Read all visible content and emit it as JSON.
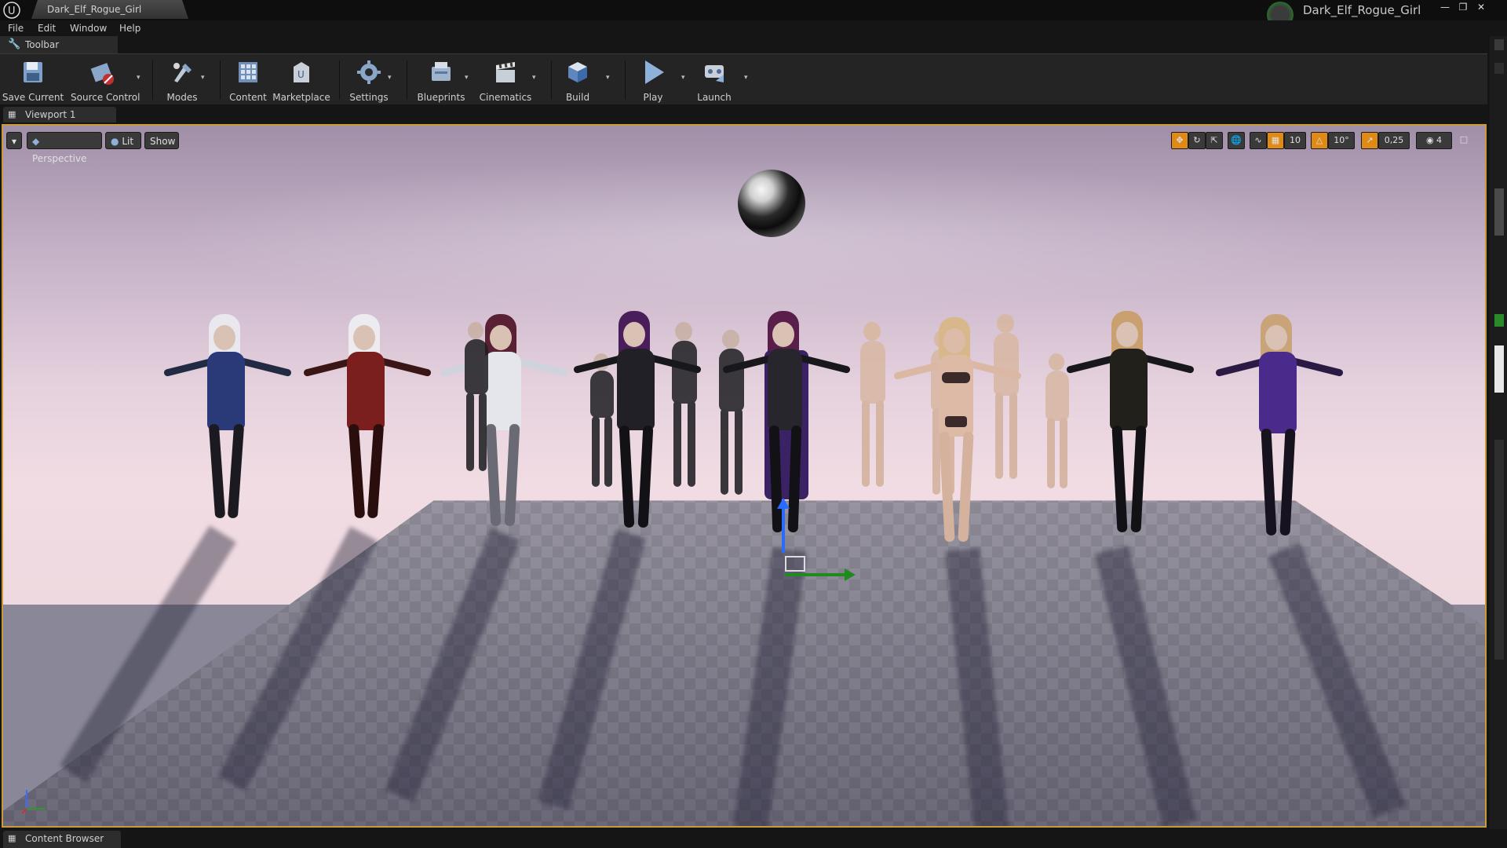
{
  "window": {
    "document_tab": "Dark_Elf_Rogue_Girl",
    "project_name": "Dark_Elf_Rogue_Girl"
  },
  "menu": {
    "items": [
      "File",
      "Edit",
      "Window",
      "Help"
    ]
  },
  "toolbar_panel": {
    "tab_label": "Toolbar",
    "buttons": [
      {
        "label": "Save Current",
        "icon": "save-icon"
      },
      {
        "label": "Source Control",
        "icon": "source-control-icon"
      },
      {
        "label": "Modes",
        "icon": "modes-icon"
      },
      {
        "label": "Content",
        "icon": "content-icon"
      },
      {
        "label": "Marketplace",
        "icon": "marketplace-icon"
      },
      {
        "label": "Settings",
        "icon": "settings-icon"
      },
      {
        "label": "Blueprints",
        "icon": "blueprints-icon"
      },
      {
        "label": "Cinematics",
        "icon": "cinematics-icon"
      },
      {
        "label": "Build",
        "icon": "build-icon"
      },
      {
        "label": "Play",
        "icon": "play-icon"
      },
      {
        "label": "Launch",
        "icon": "launch-icon"
      }
    ]
  },
  "viewport": {
    "tab_label": "Viewport 1",
    "perspective_label": "Perspective",
    "lit_label": "Lit",
    "show_label": "Show",
    "grid_snap": "10",
    "rotation_snap": "10°",
    "scale_snap": "0,25",
    "camera_speed": "4"
  },
  "bottom": {
    "content_browser_tab": "Content Browser"
  },
  "colors": {
    "accent_orange": "#e08a16",
    "viewport_border": "#c89a3a",
    "gizmo_z": "#2a6bff",
    "gizmo_x": "#1f8a1f"
  }
}
